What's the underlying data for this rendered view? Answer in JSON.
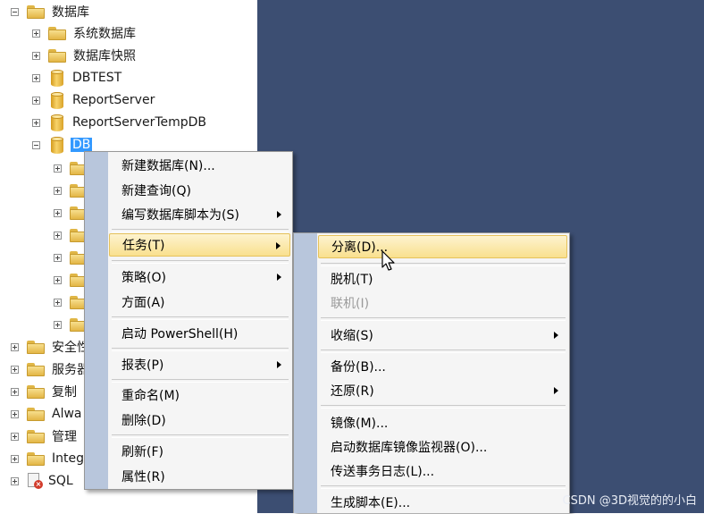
{
  "tree": {
    "root": {
      "label": "数据库",
      "expanded": true
    },
    "children": [
      {
        "label": "系统数据库",
        "icon": "folder-icon"
      },
      {
        "label": "数据库快照",
        "icon": "folder-icon"
      },
      {
        "label": "DBTEST",
        "icon": "database-icon"
      },
      {
        "label": "ReportServer",
        "icon": "database-icon"
      },
      {
        "label": "ReportServerTempDB",
        "icon": "database-icon"
      },
      {
        "label": "DB",
        "icon": "database-icon",
        "expanded": true,
        "selected": true
      }
    ],
    "bottom": [
      {
        "label": "安全性",
        "icon": "folder-icon"
      },
      {
        "label": "服务器",
        "icon": "folder-icon"
      },
      {
        "label": "复制",
        "icon": "folder-icon"
      },
      {
        "label": "Alwa",
        "icon": "folder-icon"
      },
      {
        "label": "管理",
        "icon": "folder-icon"
      },
      {
        "label": "Integ",
        "icon": "folder-icon"
      },
      {
        "label": "SQL",
        "icon": "sql-agent-icon"
      }
    ]
  },
  "menu1": {
    "items": [
      {
        "label": "新建数据库(N)..."
      },
      {
        "label": "新建查询(Q)"
      },
      {
        "label": "编写数据库脚本为(S)",
        "submenu": true
      },
      {
        "label": "任务(T)",
        "submenu": true,
        "highlighted": true
      },
      {
        "label": "策略(O)",
        "submenu": true
      },
      {
        "label": "方面(A)"
      },
      {
        "label": "启动 PowerShell(H)"
      },
      {
        "label": "报表(P)",
        "submenu": true
      },
      {
        "label": "重命名(M)"
      },
      {
        "label": "删除(D)"
      },
      {
        "label": "刷新(F)"
      },
      {
        "label": "属性(R)"
      }
    ]
  },
  "menu2": {
    "items": [
      {
        "label": "分离(D)...",
        "highlighted": true
      },
      {
        "label": "脱机(T)"
      },
      {
        "label": "联机(I)",
        "disabled": true
      },
      {
        "label": "收缩(S)",
        "submenu": true
      },
      {
        "label": "备份(B)..."
      },
      {
        "label": "还原(R)",
        "submenu": true
      },
      {
        "label": "镜像(M)..."
      },
      {
        "label": "启动数据库镜像监视器(O)..."
      },
      {
        "label": "传送事务日志(L)..."
      },
      {
        "label": "生成脚本(E)..."
      }
    ]
  },
  "watermark": "CSDN @3D视觉的的小白"
}
